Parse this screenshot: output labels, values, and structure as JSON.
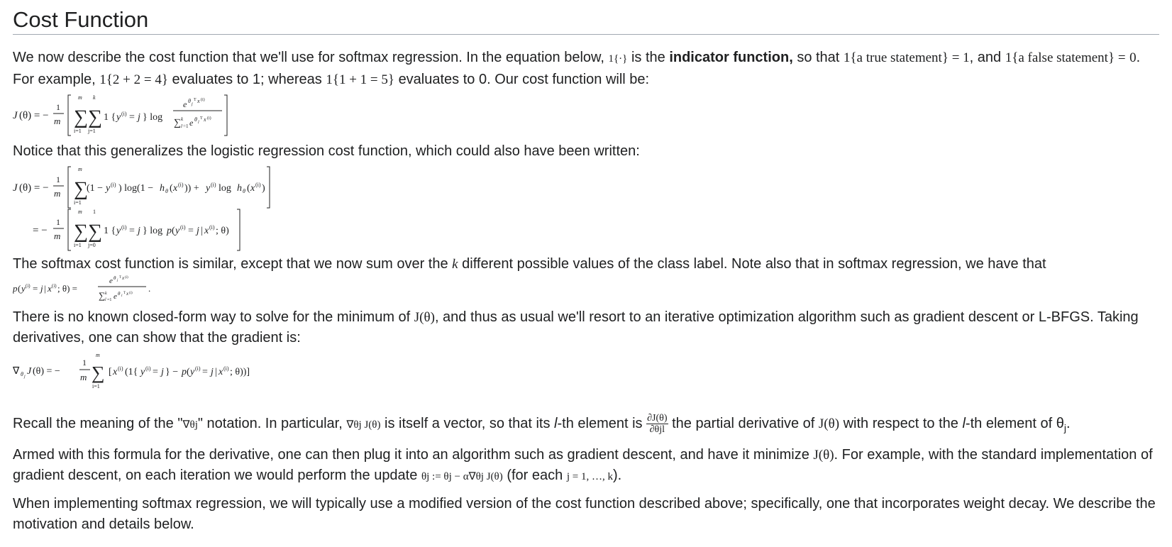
{
  "section": {
    "title": "Cost Function"
  },
  "p1": {
    "t1": "We now describe the cost function that we'll use for softmax regression. In the equation below,",
    "m1": "1{·}",
    "t2": "is the",
    "bold": "indicator function,",
    "t3": "so that",
    "m2": "1{a true statement} = 1",
    "t4": ", and",
    "m3": "1{a false statement} =",
    "m3b": "0",
    "t5": ". For example,",
    "m4": "1{2 + 2 = 4}",
    "t6": "evaluates to 1; whereas",
    "m5": "1{1 + 1 = 5}",
    "t7": "evaluates to 0. Our cost function will be:"
  },
  "eq1": {
    "lhs": "J(θ) = −",
    "frac_num": "1",
    "frac_den": "m",
    "sum1_top": "m",
    "sum1_bot": "i=1",
    "sum2_top": "k",
    "sum2_bot": "j=1",
    "body": "1 {y(i) = j} log",
    "ratio_num": "e^(θjᵀx(i))",
    "ratio_den": "∑l=1k e^(θlᵀx(i))"
  },
  "p2": {
    "text": "Notice that this generalizes the logistic regression cost function, which could also have been written:"
  },
  "eq2": {
    "line1_lhs": "J(θ) = −",
    "line1_body": "(1 − y(i)) log(1 − hθ(x(i))) + y(i) log hθ(x(i))",
    "line2_lhs": "= −",
    "line2_body": "1 {y(i) = j} log p(y(i) = j|x(i); θ)",
    "sum_top": "m",
    "sum_bot": "i=1",
    "sum2_top": "1",
    "sum2_bot": "j=0",
    "frac_num": "1",
    "frac_den": "m"
  },
  "p3": {
    "t1": "The softmax cost function is similar, except that we now sum over the",
    "k": "k",
    "t2": "different possible values of the class label. Note also that in softmax regression, we have that",
    "eq_lhs": "p(y(i) = j|x(i); θ) =",
    "eq_num": "e^(θjᵀx(i))",
    "eq_den": "∑l=1k e^(θlᵀx(i))",
    "eq_end": "."
  },
  "p4": {
    "t1": "There is no known closed-form way to solve for the minimum of",
    "j": "J(θ)",
    "t2": ", and thus as usual we'll resort to an iterative optimization algorithm such as gradient descent or L-BFGS. Taking derivatives, one can show that the gradient is:"
  },
  "eq3": {
    "lhs": "∇θj J(θ) = −",
    "frac_num": "1",
    "frac_den": "m",
    "sum_top": "m",
    "sum_bot": "i=1",
    "body": "[x(i) (1{y(i) = j} − p(y(i) = j|x(i); θ))]"
  },
  "p5": {
    "t1": "Recall the meaning of the \"",
    "nabla": "∇θj",
    "t2": "\" notation. In particular,",
    "m1": "∇θj J(θ)",
    "t3": "is itself a vector, so that its",
    "l1": "l",
    "t4": "-th element is",
    "fnum": "∂J(θ)",
    "fden": "∂θjl",
    "t5": "the partial derivative of",
    "j": "J(θ)",
    "t6": "with respect to the",
    "l2": "l",
    "t7": "-th element of θ",
    "sub": "j",
    "t8": "."
  },
  "p6": {
    "t1": "Armed with this formula for the derivative, one can then plug it into an algorithm such as gradient descent, and have it minimize",
    "j": "J(θ)",
    "t2": ". For example, with the standard implementation of gradient descent, on each iteration we would perform the update",
    "m1": "θj := θj − α∇θj J(θ)",
    "t3": "(for each",
    "m2": "j = 1, …, k",
    "t4": ")."
  },
  "p7": {
    "text": "When implementing softmax regression, we will typically use a modified version of the cost function described above; specifically, one that incorporates weight decay. We describe the motivation and details below."
  }
}
